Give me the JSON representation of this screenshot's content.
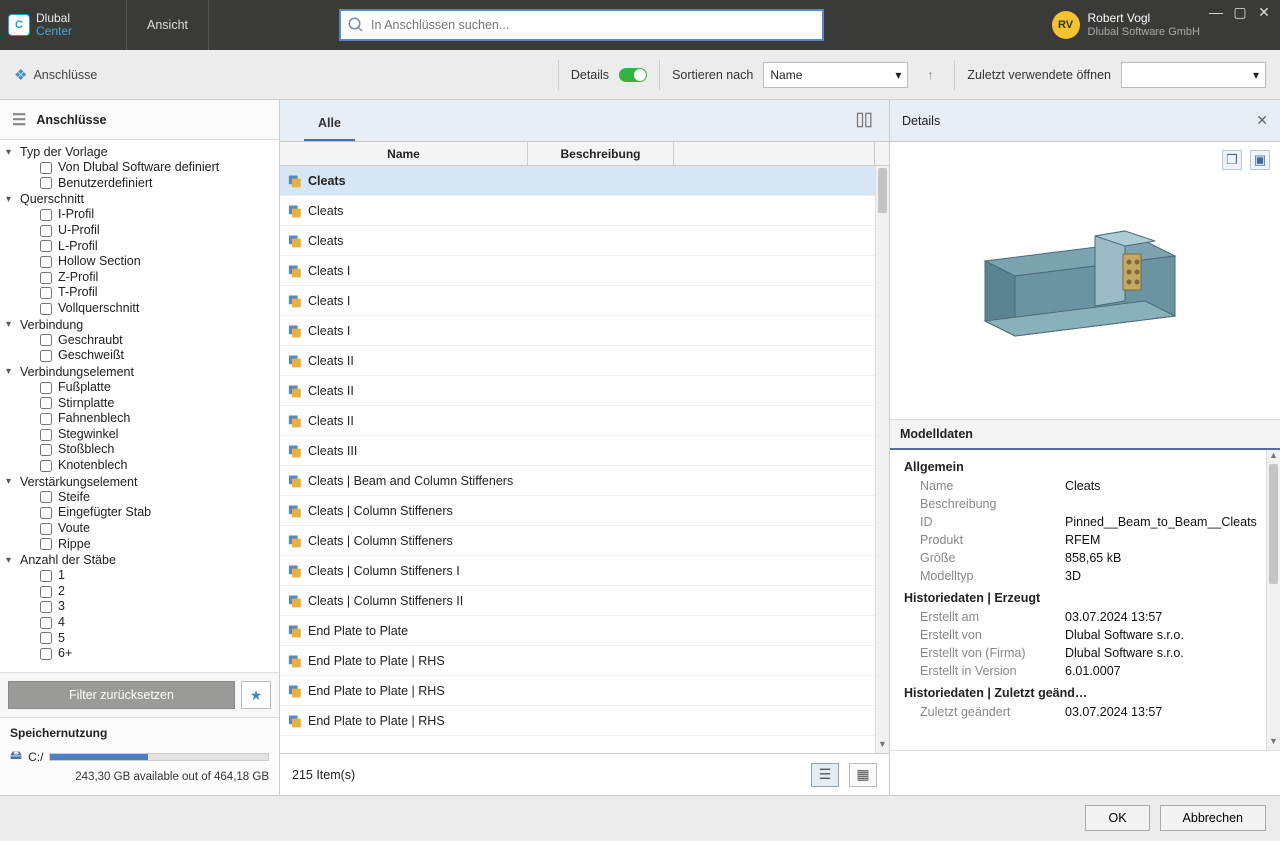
{
  "app": {
    "brand1": "Dlubal",
    "brand2": "Center",
    "menu_view": "Ansicht"
  },
  "search": {
    "placeholder": "In Anschlüssen suchen..."
  },
  "user": {
    "initials": "RV",
    "name": "Robert Vogl",
    "company": "Dlubal Software GmbH"
  },
  "toolbar": {
    "breadcrumb": "Anschlüsse",
    "details_label": "Details",
    "sort_label": "Sortieren nach",
    "sort_value": "Name",
    "recent_label": "Zuletzt verwendete öffnen"
  },
  "sidebar": {
    "title": "Anschlüsse",
    "groups": [
      {
        "label": "Typ der Vorlage",
        "items": [
          "Von Dlubal Software definiert",
          "Benutzerdefiniert"
        ]
      },
      {
        "label": "Querschnitt",
        "items": [
          "I-Profil",
          "U-Profil",
          "L-Profil",
          "Hollow Section",
          "Z-Profil",
          "T-Profil",
          "Vollquerschnitt"
        ]
      },
      {
        "label": "Verbindung",
        "items": [
          "Geschraubt",
          "Geschweißt"
        ]
      },
      {
        "label": "Verbindungselement",
        "items": [
          "Fußplatte",
          "Stirnplatte",
          "Fahnenblech",
          "Stegwinkel",
          "Stoßblech",
          "Knotenblech"
        ]
      },
      {
        "label": "Verstärkungselement",
        "items": [
          "Steife",
          "Eingefügter Stab",
          "Voute",
          "Rippe"
        ]
      },
      {
        "label": "Anzahl der Stäbe",
        "items": [
          "1",
          "2",
          "3",
          "4",
          "5",
          "6+"
        ]
      }
    ],
    "reset": "Filter zurücksetzen",
    "storage_title": "Speichernutzung",
    "storage_drive": "C:/",
    "storage_detail": "243,30 GB available out of 464,18 GB"
  },
  "list": {
    "tab_all": "Alle",
    "col_name": "Name",
    "col_desc": "Beschreibung",
    "rows": [
      "Cleats",
      "Cleats",
      "Cleats",
      "Cleats I",
      "Cleats I",
      "Cleats I",
      "Cleats II",
      "Cleats II",
      "Cleats II",
      "Cleats III",
      "Cleats | Beam and Column Stiffeners",
      "Cleats | Column Stiffeners",
      "Cleats | Column Stiffeners",
      "Cleats | Column Stiffeners I",
      "Cleats | Column Stiffeners II",
      "End Plate to Plate",
      "End Plate to Plate | RHS",
      "End Plate to Plate | RHS",
      "End Plate to Plate | RHS"
    ],
    "count": "215 Item(s)"
  },
  "details": {
    "title": "Details",
    "section_model": "Modelldaten",
    "sub_general": "Allgemein",
    "k_name": "Name",
    "v_name": "Cleats",
    "k_desc": "Beschreibung",
    "v_desc": "",
    "k_id": "ID",
    "v_id": "Pinned__Beam_to_Beam__Cleats",
    "k_product": "Produkt",
    "v_product": "RFEM",
    "k_size": "Größe",
    "v_size": "858,65 kB",
    "k_modeltype": "Modelltyp",
    "v_modeltype": "3D",
    "sub_hist_created": "Historiedaten | Erzeugt",
    "k_created_on": "Erstellt am",
    "v_created_on": "03.07.2024 13:57",
    "k_created_by": "Erstellt von",
    "v_created_by": "Dlubal Software s.r.o.",
    "k_created_by_co": "Erstellt von (Firma)",
    "v_created_by_co": "Dlubal Software s.r.o.",
    "k_created_ver": "Erstellt in Version",
    "v_created_ver": "6.01.0007",
    "sub_hist_mod": "Historiedaten | Zuletzt geänd…",
    "k_mod_on": "Zuletzt geändert",
    "v_mod_on": "03.07.2024 13:57"
  },
  "buttons": {
    "ok": "OK",
    "cancel": "Abbrechen"
  }
}
